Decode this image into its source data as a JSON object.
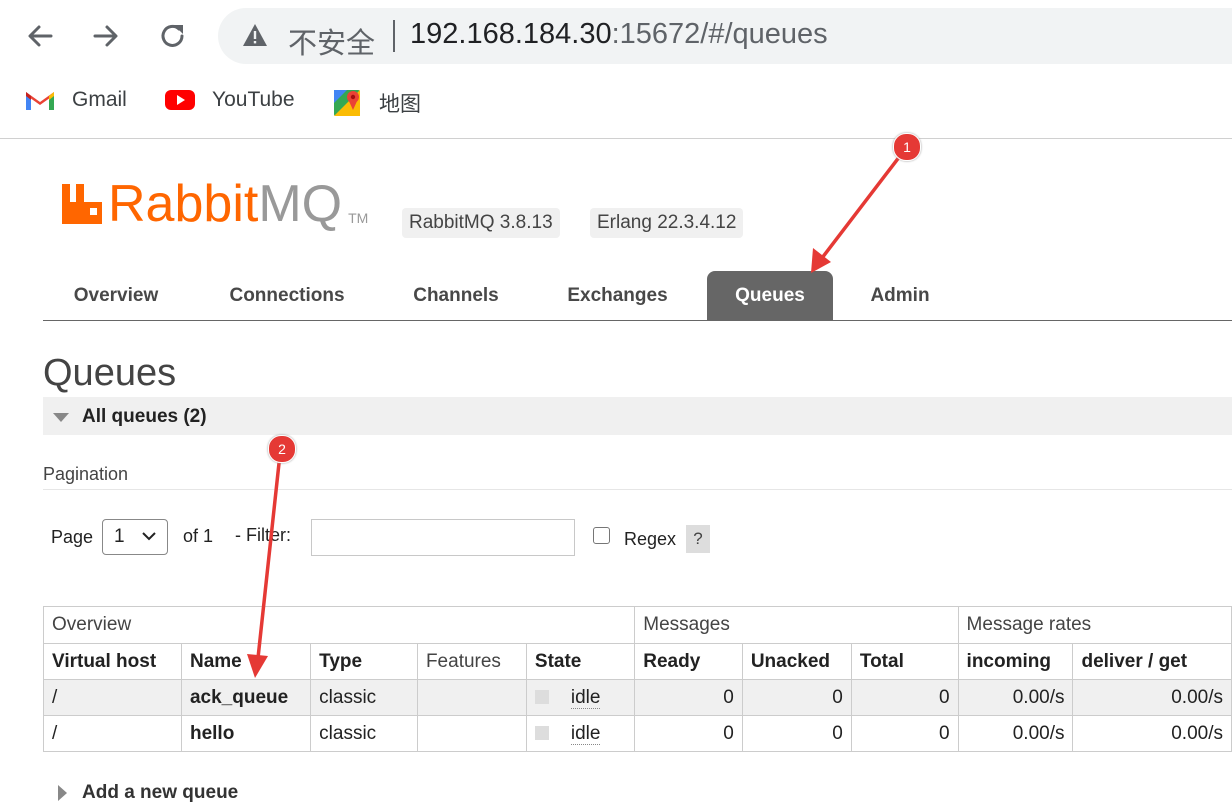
{
  "browser": {
    "security_label": "不安全",
    "url_host": "192.168.184.30",
    "url_rest": ":15672/#/queues",
    "bookmarks": [
      {
        "label": "Gmail",
        "icon": "gmail-icon"
      },
      {
        "label": "YouTube",
        "icon": "youtube-icon"
      },
      {
        "label": "地图",
        "icon": "maps-icon"
      }
    ]
  },
  "header": {
    "logo_rabbit": "Rabbit",
    "logo_mq": "MQ",
    "logo_tm": "TM",
    "version": "RabbitMQ 3.8.13",
    "erlang": "Erlang 22.3.4.12"
  },
  "tabs": [
    {
      "label": "Overview"
    },
    {
      "label": "Connections"
    },
    {
      "label": "Channels"
    },
    {
      "label": "Exchanges"
    },
    {
      "label": "Queues",
      "active": true
    },
    {
      "label": "Admin"
    }
  ],
  "page": {
    "title": "Queues",
    "section_label": "All queues (2)",
    "pagination_label": "Pagination",
    "page_label": "Page",
    "page_value": "1",
    "of_label": "of 1",
    "filter_label": "- Filter:",
    "filter_value": "",
    "regex_label": "Regex",
    "help_label": "?",
    "add_queue_label": "Add a new queue"
  },
  "table": {
    "groups": [
      "Overview",
      "Messages",
      "Message rates"
    ],
    "columns": [
      "Virtual host",
      "Name",
      "Type",
      "Features",
      "State",
      "Ready",
      "Unacked",
      "Total",
      "incoming",
      "deliver / get"
    ],
    "rows": [
      {
        "vhost": "/",
        "name": "ack_queue",
        "type": "classic",
        "features": "",
        "state": "idle",
        "ready": "0",
        "unacked": "0",
        "total": "0",
        "incoming": "0.00/s",
        "deliver": "0.00/s"
      },
      {
        "vhost": "/",
        "name": "hello",
        "type": "classic",
        "features": "",
        "state": "idle",
        "ready": "0",
        "unacked": "0",
        "total": "0",
        "incoming": "0.00/s",
        "deliver": "0.00/s"
      }
    ]
  },
  "annotations": {
    "marker1": "1",
    "marker2": "2",
    "color": "#e53935"
  }
}
